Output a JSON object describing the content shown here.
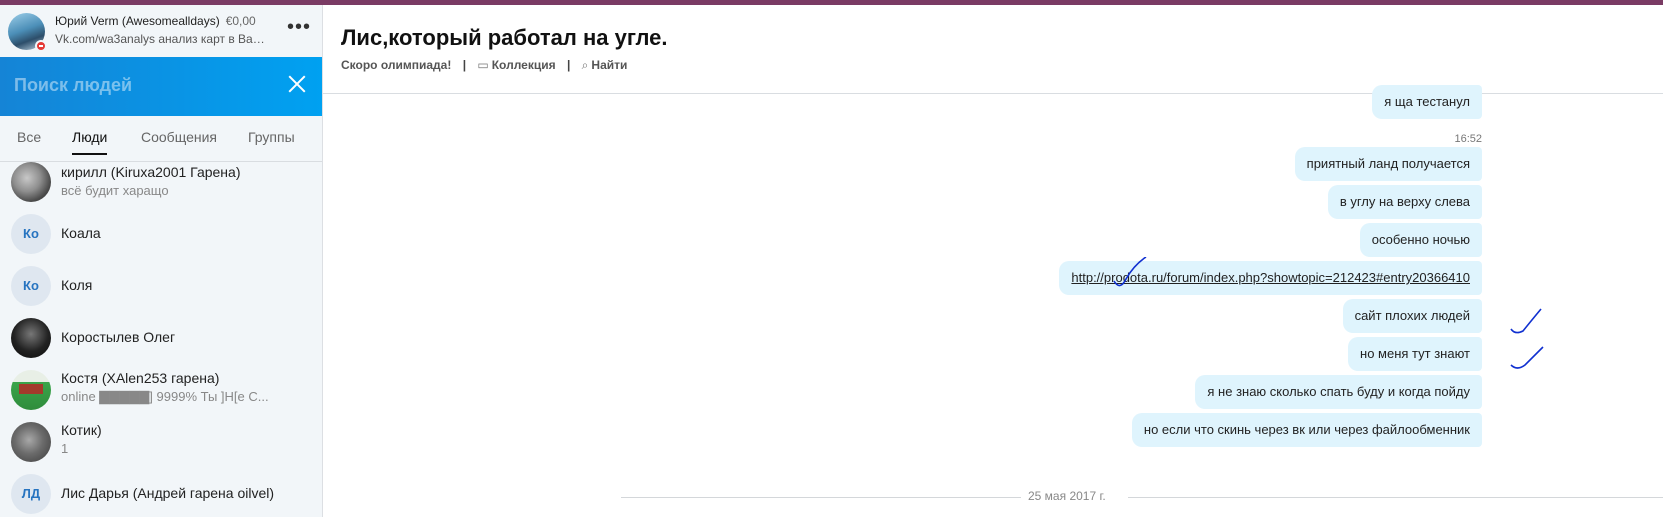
{
  "profile": {
    "name": "Юрий Verm (Awesomealldays)",
    "balance": "€0,00",
    "mood": "Vk.com/wa3analys анализ карт в Вар...",
    "more_label": "•••"
  },
  "search": {
    "placeholder": "Поиск людей"
  },
  "tabs": [
    {
      "label": "Все",
      "active": false
    },
    {
      "label": "Люди",
      "active": true
    },
    {
      "label": "Сообщения",
      "active": false
    },
    {
      "label": "Группы",
      "active": false
    }
  ],
  "contacts": [
    {
      "name": "кирилл (Kiruxa2001 Гарена)",
      "status": "всё будит харащо",
      "avatar": "photo"
    },
    {
      "name": "Коала",
      "status": "",
      "initials": "Ко"
    },
    {
      "name": "Коля",
      "status": "",
      "initials": "Ко"
    },
    {
      "name": "Коростылев Олег",
      "status": "",
      "avatar": "photo"
    },
    {
      "name": "Костя (XAlen253 гарена)",
      "status": "online ▇▇▇▇▇] 9999% Ты    ]H[e     C...",
      "avatar": "photo"
    },
    {
      "name": "Котик)",
      "status": "1",
      "avatar": "photo"
    },
    {
      "name": "Лис Дарья (Андрей гарена oilvel)",
      "status": "",
      "initials": "ЛД"
    }
  ],
  "chat": {
    "title": "Лис,который работал на угле.",
    "meta": {
      "mood": "Скоро олимпиада!",
      "collection_icon": "gallery-icon",
      "collection": "Коллекция",
      "find_icon": "search-icon",
      "find": "Найти",
      "separator": "|"
    },
    "messages": [
      {
        "text": "я ща тестанул"
      },
      {
        "time": "16:52"
      },
      {
        "text": "приятный ланд получается"
      },
      {
        "text": "в углу на верху слева"
      },
      {
        "text": "особенно ночью"
      },
      {
        "text": "http://prodota.ru/forum/index.php?showtopic=212423#entry20366410",
        "link": true
      },
      {
        "text": "сайт плохих людей"
      },
      {
        "text": "но меня тут знают"
      },
      {
        "text": "я не знаю сколько спать буду и когда пойду"
      },
      {
        "text": "но если что скинь через вк или через файлообменник"
      }
    ],
    "date_separator": "25 мая 2017 г."
  },
  "colors": {
    "accent_bar": "#7a3b64",
    "search_bar": "#00a1f1",
    "bubble": "#dff4fd",
    "annotation": "#1030d0"
  }
}
